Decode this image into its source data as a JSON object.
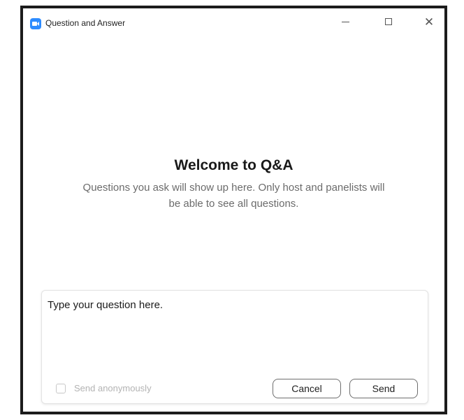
{
  "window": {
    "title": "Question and Answer",
    "icon": "zoom-camera-icon",
    "controls": {
      "minimize": "−",
      "maximize": "☐",
      "close": "✕"
    }
  },
  "welcome": {
    "title": "Welcome to Q&A",
    "description": "Questions you ask will show up here. Only host and panelists will be able to see all questions."
  },
  "composer": {
    "placeholder": "Type your question here.",
    "value": "",
    "anonymous_label": "Send anonymously",
    "anonymous_checked": false,
    "cancel_label": "Cancel",
    "send_label": "Send"
  },
  "colors": {
    "accent": "#2d8cff",
    "frame": "#1c1c1c",
    "muted_text": "#6b6b6b",
    "disabled_text": "#b3b3b3"
  }
}
